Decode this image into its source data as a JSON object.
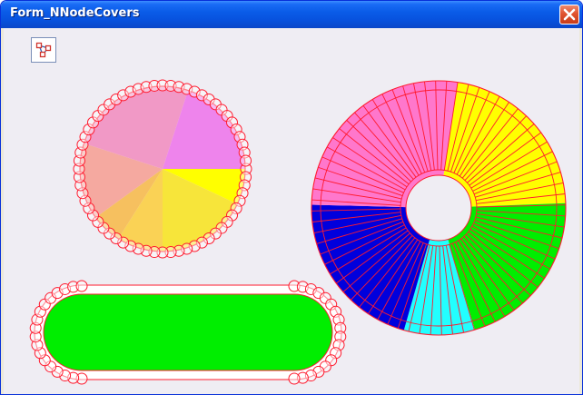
{
  "window": {
    "title": "Form_NNodeCovers"
  },
  "colors": {
    "titlebar": "#0a5ce8",
    "client_background": "#efedf3",
    "outline": "#ff1a2e",
    "node_fill": "#ffffff"
  },
  "icons": {
    "close": "close-icon",
    "tool": "node-graph-icon"
  },
  "scene": {
    "pie_disc": {
      "node_count": 64,
      "slices": [
        {
          "color": "#ffff00",
          "fraction": 0.07
        },
        {
          "color": "#f7e53a",
          "fraction": 0.18
        },
        {
          "color": "#fad255",
          "fraction": 0.09
        },
        {
          "color": "#f6c05f",
          "fraction": 0.06
        },
        {
          "color": "#f5a9a0",
          "fraction": 0.15
        },
        {
          "color": "#f199c6",
          "fraction": 0.25
        },
        {
          "color": "#ee84ec",
          "fraction": 0.2
        }
      ]
    },
    "annulus": {
      "segment_count": 72,
      "sectors": [
        {
          "color": "#ffff00",
          "fraction": 0.22
        },
        {
          "color": "#00ee00",
          "fraction": 0.21
        },
        {
          "color": "#22ffff",
          "fraction": 0.09
        },
        {
          "color": "#0000dd",
          "fraction": 0.21
        },
        {
          "color": "#ff77cc",
          "fraction": 0.27
        }
      ]
    },
    "capsule": {
      "fill": "#00ee00",
      "node_count": 36
    }
  }
}
